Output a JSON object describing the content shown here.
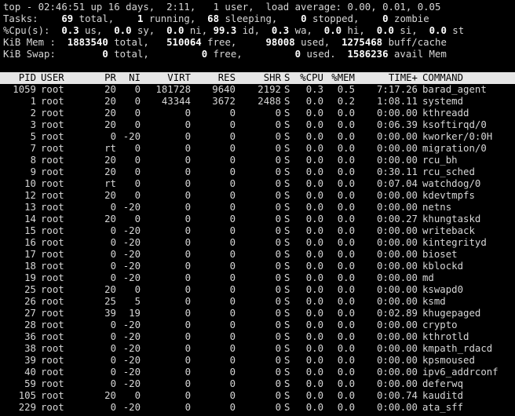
{
  "summary": {
    "top": {
      "prefix": "top - ",
      "time": "02:46:51",
      "uptime": "up 16 days,  2:11,",
      "users": "1 user,",
      "load": "load average: 0.00, 0.01, 0.05"
    },
    "tasks": {
      "label": "Tasks:",
      "total": "69",
      "total_l": "total,",
      "running": "1",
      "running_l": "running,",
      "sleeping": "68",
      "sleeping_l": "sleeping,",
      "stopped": "0",
      "stopped_l": "stopped,",
      "zombie": "0",
      "zombie_l": "zombie"
    },
    "cpu": {
      "label": "%Cpu(s):",
      "us": "0.3",
      "sy": "0.0",
      "ni": "0.0",
      "id": "99.3",
      "wa": "0.3",
      "hi": "0.0",
      "si": "0.0",
      "st": "0.0"
    },
    "mem": {
      "label": "KiB Mem :",
      "total": "1883540",
      "free": "510064",
      "used": "98008",
      "buff": "1275468",
      "buff_l": "buff/cache"
    },
    "swap": {
      "label": "KiB Swap:",
      "total": "0",
      "free": "0",
      "used": "0",
      "avail": "1586236",
      "avail_l": "avail Mem"
    }
  },
  "columns": {
    "pid": "PID",
    "user": "USER",
    "pr": "PR",
    "ni": "NI",
    "virt": "VIRT",
    "res": "RES",
    "shr": "SHR",
    "s": "S",
    "cpu": "%CPU",
    "mem": "%MEM",
    "time": "TIME+",
    "cmd": "COMMAND"
  },
  "processes": [
    {
      "pid": "1059",
      "user": "root",
      "pr": "20",
      "ni": "0",
      "virt": "181728",
      "res": "9640",
      "shr": "2192",
      "s": "S",
      "cpu": "0.3",
      "mem": "0.5",
      "time": "7:17.26",
      "cmd": "barad_agent"
    },
    {
      "pid": "1",
      "user": "root",
      "pr": "20",
      "ni": "0",
      "virt": "43344",
      "res": "3672",
      "shr": "2488",
      "s": "S",
      "cpu": "0.0",
      "mem": "0.2",
      "time": "1:08.11",
      "cmd": "systemd"
    },
    {
      "pid": "2",
      "user": "root",
      "pr": "20",
      "ni": "0",
      "virt": "0",
      "res": "0",
      "shr": "0",
      "s": "S",
      "cpu": "0.0",
      "mem": "0.0",
      "time": "0:00.00",
      "cmd": "kthreadd"
    },
    {
      "pid": "3",
      "user": "root",
      "pr": "20",
      "ni": "0",
      "virt": "0",
      "res": "0",
      "shr": "0",
      "s": "S",
      "cpu": "0.0",
      "mem": "0.0",
      "time": "0:06.39",
      "cmd": "ksoftirqd/0"
    },
    {
      "pid": "5",
      "user": "root",
      "pr": "0",
      "ni": "-20",
      "virt": "0",
      "res": "0",
      "shr": "0",
      "s": "S",
      "cpu": "0.0",
      "mem": "0.0",
      "time": "0:00.00",
      "cmd": "kworker/0:0H"
    },
    {
      "pid": "7",
      "user": "root",
      "pr": "rt",
      "ni": "0",
      "virt": "0",
      "res": "0",
      "shr": "0",
      "s": "S",
      "cpu": "0.0",
      "mem": "0.0",
      "time": "0:00.00",
      "cmd": "migration/0"
    },
    {
      "pid": "8",
      "user": "root",
      "pr": "20",
      "ni": "0",
      "virt": "0",
      "res": "0",
      "shr": "0",
      "s": "S",
      "cpu": "0.0",
      "mem": "0.0",
      "time": "0:00.00",
      "cmd": "rcu_bh"
    },
    {
      "pid": "9",
      "user": "root",
      "pr": "20",
      "ni": "0",
      "virt": "0",
      "res": "0",
      "shr": "0",
      "s": "S",
      "cpu": "0.0",
      "mem": "0.0",
      "time": "0:30.11",
      "cmd": "rcu_sched"
    },
    {
      "pid": "10",
      "user": "root",
      "pr": "rt",
      "ni": "0",
      "virt": "0",
      "res": "0",
      "shr": "0",
      "s": "S",
      "cpu": "0.0",
      "mem": "0.0",
      "time": "0:07.04",
      "cmd": "watchdog/0"
    },
    {
      "pid": "12",
      "user": "root",
      "pr": "20",
      "ni": "0",
      "virt": "0",
      "res": "0",
      "shr": "0",
      "s": "S",
      "cpu": "0.0",
      "mem": "0.0",
      "time": "0:00.00",
      "cmd": "kdevtmpfs"
    },
    {
      "pid": "13",
      "user": "root",
      "pr": "0",
      "ni": "-20",
      "virt": "0",
      "res": "0",
      "shr": "0",
      "s": "S",
      "cpu": "0.0",
      "mem": "0.0",
      "time": "0:00.00",
      "cmd": "netns"
    },
    {
      "pid": "14",
      "user": "root",
      "pr": "20",
      "ni": "0",
      "virt": "0",
      "res": "0",
      "shr": "0",
      "s": "S",
      "cpu": "0.0",
      "mem": "0.0",
      "time": "0:00.27",
      "cmd": "khungtaskd"
    },
    {
      "pid": "15",
      "user": "root",
      "pr": "0",
      "ni": "-20",
      "virt": "0",
      "res": "0",
      "shr": "0",
      "s": "S",
      "cpu": "0.0",
      "mem": "0.0",
      "time": "0:00.00",
      "cmd": "writeback"
    },
    {
      "pid": "16",
      "user": "root",
      "pr": "0",
      "ni": "-20",
      "virt": "0",
      "res": "0",
      "shr": "0",
      "s": "S",
      "cpu": "0.0",
      "mem": "0.0",
      "time": "0:00.00",
      "cmd": "kintegrityd"
    },
    {
      "pid": "17",
      "user": "root",
      "pr": "0",
      "ni": "-20",
      "virt": "0",
      "res": "0",
      "shr": "0",
      "s": "S",
      "cpu": "0.0",
      "mem": "0.0",
      "time": "0:00.00",
      "cmd": "bioset"
    },
    {
      "pid": "18",
      "user": "root",
      "pr": "0",
      "ni": "-20",
      "virt": "0",
      "res": "0",
      "shr": "0",
      "s": "S",
      "cpu": "0.0",
      "mem": "0.0",
      "time": "0:00.00",
      "cmd": "kblockd"
    },
    {
      "pid": "19",
      "user": "root",
      "pr": "0",
      "ni": "-20",
      "virt": "0",
      "res": "0",
      "shr": "0",
      "s": "S",
      "cpu": "0.0",
      "mem": "0.0",
      "time": "0:00.00",
      "cmd": "md"
    },
    {
      "pid": "25",
      "user": "root",
      "pr": "20",
      "ni": "0",
      "virt": "0",
      "res": "0",
      "shr": "0",
      "s": "S",
      "cpu": "0.0",
      "mem": "0.0",
      "time": "0:00.00",
      "cmd": "kswapd0"
    },
    {
      "pid": "26",
      "user": "root",
      "pr": "25",
      "ni": "5",
      "virt": "0",
      "res": "0",
      "shr": "0",
      "s": "S",
      "cpu": "0.0",
      "mem": "0.0",
      "time": "0:00.00",
      "cmd": "ksmd"
    },
    {
      "pid": "27",
      "user": "root",
      "pr": "39",
      "ni": "19",
      "virt": "0",
      "res": "0",
      "shr": "0",
      "s": "S",
      "cpu": "0.0",
      "mem": "0.0",
      "time": "0:02.89",
      "cmd": "khugepaged"
    },
    {
      "pid": "28",
      "user": "root",
      "pr": "0",
      "ni": "-20",
      "virt": "0",
      "res": "0",
      "shr": "0",
      "s": "S",
      "cpu": "0.0",
      "mem": "0.0",
      "time": "0:00.00",
      "cmd": "crypto"
    },
    {
      "pid": "36",
      "user": "root",
      "pr": "0",
      "ni": "-20",
      "virt": "0",
      "res": "0",
      "shr": "0",
      "s": "S",
      "cpu": "0.0",
      "mem": "0.0",
      "time": "0:00.00",
      "cmd": "kthrotld"
    },
    {
      "pid": "38",
      "user": "root",
      "pr": "0",
      "ni": "-20",
      "virt": "0",
      "res": "0",
      "shr": "0",
      "s": "S",
      "cpu": "0.0",
      "mem": "0.0",
      "time": "0:00.00",
      "cmd": "kmpath_rdacd"
    },
    {
      "pid": "39",
      "user": "root",
      "pr": "0",
      "ni": "-20",
      "virt": "0",
      "res": "0",
      "shr": "0",
      "s": "S",
      "cpu": "0.0",
      "mem": "0.0",
      "time": "0:00.00",
      "cmd": "kpsmoused"
    },
    {
      "pid": "40",
      "user": "root",
      "pr": "0",
      "ni": "-20",
      "virt": "0",
      "res": "0",
      "shr": "0",
      "s": "S",
      "cpu": "0.0",
      "mem": "0.0",
      "time": "0:00.00",
      "cmd": "ipv6_addrconf"
    },
    {
      "pid": "59",
      "user": "root",
      "pr": "0",
      "ni": "-20",
      "virt": "0",
      "res": "0",
      "shr": "0",
      "s": "S",
      "cpu": "0.0",
      "mem": "0.0",
      "time": "0:00.00",
      "cmd": "deferwq"
    },
    {
      "pid": "105",
      "user": "root",
      "pr": "20",
      "ni": "0",
      "virt": "0",
      "res": "0",
      "shr": "0",
      "s": "S",
      "cpu": "0.0",
      "mem": "0.0",
      "time": "0:00.74",
      "cmd": "kauditd"
    },
    {
      "pid": "229",
      "user": "root",
      "pr": "0",
      "ni": "-20",
      "virt": "0",
      "res": "0",
      "shr": "0",
      "s": "S",
      "cpu": "0.0",
      "mem": "0.0",
      "time": "0:00.00",
      "cmd": "ata_sff"
    }
  ]
}
